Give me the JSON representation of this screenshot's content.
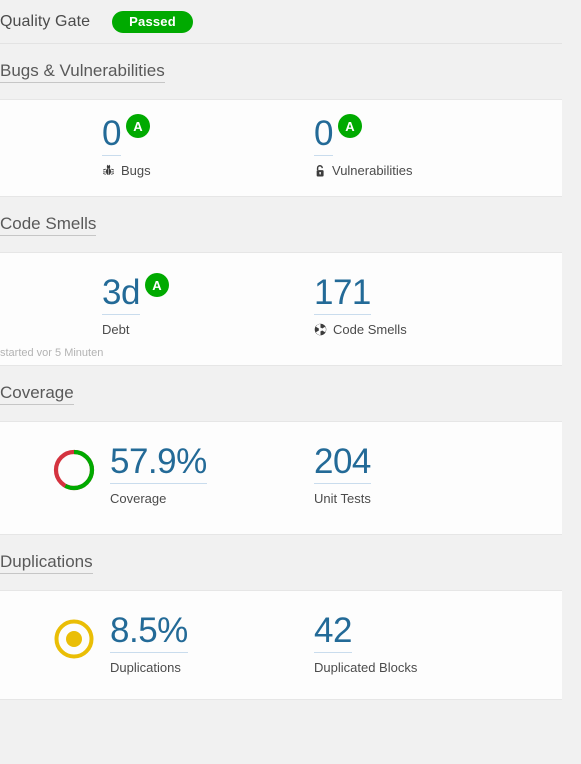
{
  "quality_gate": {
    "title": "Quality Gate",
    "status": "Passed",
    "status_color": "#00aa00"
  },
  "colors": {
    "value_link": "#236a97",
    "rating_a": "#00aa00",
    "coverage_green": "#00aa00",
    "coverage_red": "#d4333f",
    "duplications_yellow": "#eabe06"
  },
  "sections": [
    {
      "id": "bugs-vulnerabilities",
      "title": "Bugs & Vulnerabilities",
      "note": null,
      "measures": [
        {
          "id": "bugs",
          "value": "0",
          "label": "Bugs",
          "icon": "bug-icon",
          "rating": "A",
          "rating_color": "#00aa00",
          "indicator": null
        },
        {
          "id": "vulnerabilities",
          "value": "0",
          "label": "Vulnerabilities",
          "icon": "open-padlock-icon",
          "rating": "A",
          "rating_color": "#00aa00",
          "indicator": null
        }
      ]
    },
    {
      "id": "code-smells",
      "title": "Code Smells",
      "note": "started vor 5 Minuten",
      "measures": [
        {
          "id": "debt",
          "value": "3d",
          "label": "Debt",
          "icon": null,
          "rating": "A",
          "rating_color": "#00aa00",
          "indicator": null
        },
        {
          "id": "code-smells",
          "value": "171",
          "label": "Code Smells",
          "icon": "code-smell-icon",
          "rating": null,
          "rating_color": null,
          "indicator": null
        }
      ]
    },
    {
      "id": "coverage",
      "title": "Coverage",
      "note": null,
      "measures": [
        {
          "id": "coverage",
          "value": "57.9%",
          "label": "Coverage",
          "icon": null,
          "rating": null,
          "rating_color": null,
          "indicator": "coverage-donut",
          "indicator_percent": 57.9
        },
        {
          "id": "unit-tests",
          "value": "204",
          "label": "Unit Tests",
          "icon": null,
          "rating": null,
          "rating_color": null,
          "indicator": null
        }
      ]
    },
    {
      "id": "duplications",
      "title": "Duplications",
      "note": null,
      "measures": [
        {
          "id": "duplications",
          "value": "8.5%",
          "label": "Duplications",
          "icon": null,
          "rating": null,
          "rating_color": null,
          "indicator": "duplications-dot",
          "indicator_percent": 8.5
        },
        {
          "id": "duplicated-blocks",
          "value": "42",
          "label": "Duplicated Blocks",
          "icon": null,
          "rating": null,
          "rating_color": null,
          "indicator": null
        }
      ]
    }
  ]
}
